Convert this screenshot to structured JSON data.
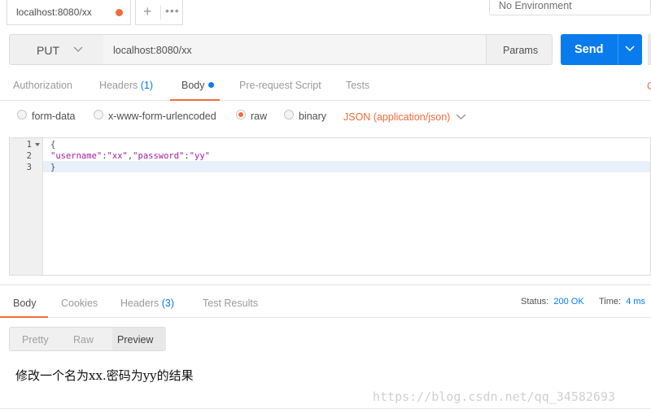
{
  "tabs": {
    "request_tab_label": "localhost:8080/xx",
    "more_label": "•••"
  },
  "environment": {
    "label": "No Environment"
  },
  "request": {
    "method": "PUT",
    "url": "localhost:8080/xx",
    "params_label": "Params",
    "send_label": "Send"
  },
  "request_tabs": [
    {
      "label": "Authorization",
      "count": ""
    },
    {
      "label": "Headers",
      "count": "(1)"
    },
    {
      "label": "Body",
      "count": ""
    },
    {
      "label": "Pre-request Script",
      "count": ""
    },
    {
      "label": "Tests",
      "count": ""
    }
  ],
  "right_edge_glyph": "C",
  "body_types": [
    {
      "label": "form-data",
      "selected": false
    },
    {
      "label": "x-www-form-urlencoded",
      "selected": false
    },
    {
      "label": "raw",
      "selected": true
    },
    {
      "label": "binary",
      "selected": false
    }
  ],
  "content_type": "JSON (application/json)",
  "editor": {
    "line_numbers": [
      "1",
      "2",
      "3"
    ],
    "line1": "{",
    "line2": {
      "key1": "\"username\"",
      "sep1": ":",
      "val1": "\"xx\"",
      "comma": ",",
      "key2": "\"password\"",
      "sep2": ":",
      "val2": "\"yy\""
    },
    "line3": "}"
  },
  "response_tabs": [
    {
      "label": "Body",
      "count": ""
    },
    {
      "label": "Cookies",
      "count": ""
    },
    {
      "label": "Headers",
      "count": "(3)"
    },
    {
      "label": "Test Results",
      "count": ""
    }
  ],
  "status": {
    "label": "Status:",
    "value": "200 OK"
  },
  "time": {
    "label": "Time:",
    "value": "4 ms"
  },
  "view_modes": [
    "Pretty",
    "Raw",
    "Preview"
  ],
  "result_text": "修改一个名为xx.密码为yy的结果",
  "watermark": "https://blog.csdn.net/qq_34582693",
  "colors": {
    "accent_orange": "#f26b3a",
    "send_blue": "#097bed",
    "json_string": "#a31da1"
  }
}
